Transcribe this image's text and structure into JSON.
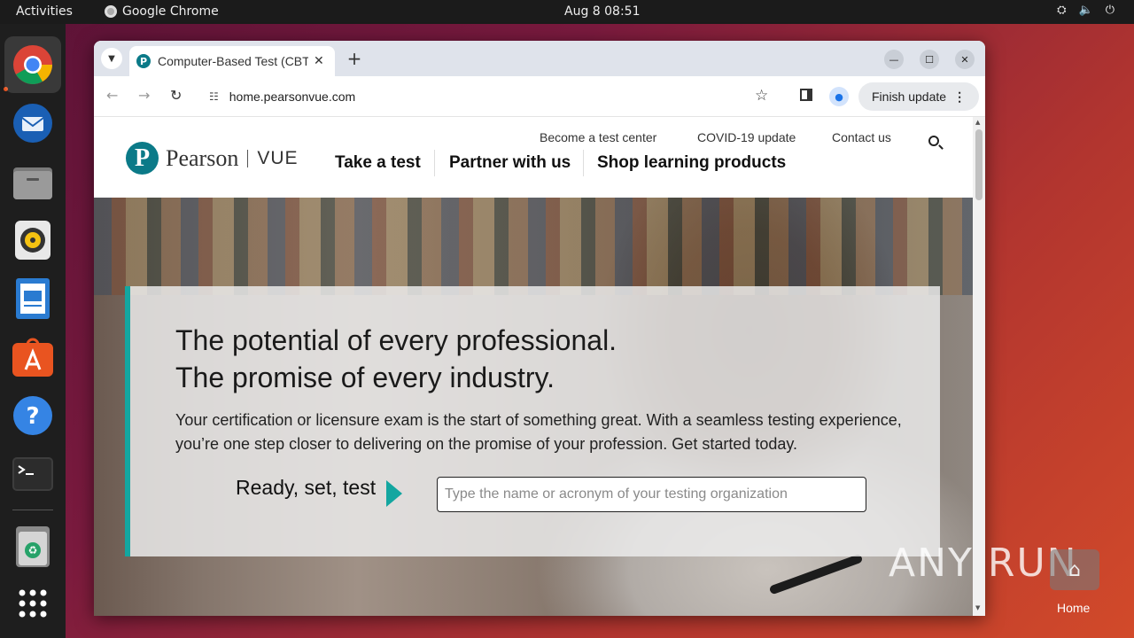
{
  "topbar": {
    "activities": "Activities",
    "app_name": "Google Chrome",
    "clock": "Aug 8  08:51"
  },
  "dock": {
    "items": [
      "chrome-icon",
      "thunderbird-icon",
      "files-icon",
      "rhythmbox-icon",
      "writer-icon",
      "app-center-icon",
      "help-icon",
      "terminal-icon",
      "trash-icon",
      "app-grid-icon"
    ]
  },
  "browser": {
    "tab_title": "Computer-Based Test (CBT)",
    "url": "home.pearsonvue.com",
    "finish_update": "Finish update"
  },
  "site": {
    "logo_name": "Pearson",
    "logo_product": "VUE",
    "utility_links": [
      "Become a test center",
      "COVID-19 update",
      "Contact us"
    ],
    "main_nav": [
      "Take a test",
      "Partner with us",
      "Shop learning products"
    ],
    "hero": {
      "headline_line1": "The potential of every professional.",
      "headline_line2": "The promise of every industry.",
      "subtext": "Your certification or licensure exam is the start of something great. With a seamless testing experience, you’re one step closer to delivering on the promise of your profession. Get started today.",
      "ready_label": "Ready, set, test",
      "search_placeholder": "Type the name or acronym of your testing organization"
    }
  },
  "desktop": {
    "watermark": "ANY RUN",
    "home_label": "Home"
  },
  "colors": {
    "accent_teal": "#13a6a0",
    "pearson_blue": "#0b7a88",
    "ubuntu_orange": "#e95420"
  }
}
